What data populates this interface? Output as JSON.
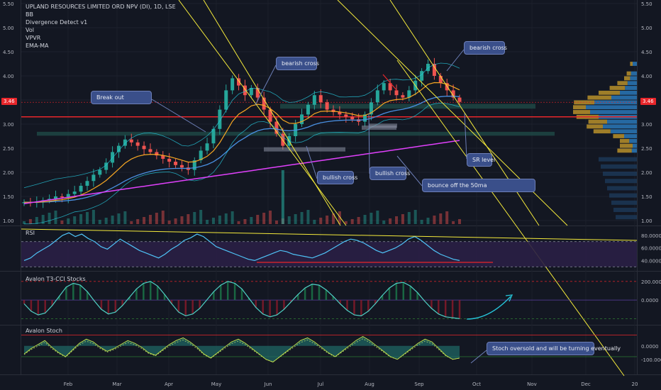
{
  "legend": [
    "UPLAND RESOURCES LIMITED ORD NPV (DI), 1D, LSE",
    "BB",
    "Divergence Detect v1",
    "Vol",
    "VPVR",
    "EMA-MA"
  ],
  "current_price": "3.46",
  "pane_titles": {
    "rsi": "RSI",
    "t3": "Avalon T3-CCI Stocks",
    "stoch": "Avalon Stoch"
  },
  "annotations": {
    "breakout": "Break out",
    "bearish1": "bearish cross",
    "bearish2": "bearish cross",
    "bullish1": "bullish cross",
    "bullish2": "bullish cross",
    "bounce": "bounce off the 50ma",
    "sr": "SR level",
    "stoch": "Stoch oversold and will be turning eventually"
  },
  "colors": {
    "background": "#131722",
    "bull": "#26a69a",
    "bear": "#ef5350",
    "support_red": "#e8262b",
    "trendline_yellow": "#f5eb3b",
    "sma200_magenta": "#e040fb",
    "rsi_line": "#4fc3f7",
    "zone_teal": "#1f4a47",
    "vpvr_up": "#b8902a",
    "vpvr_down": "#2a78b8",
    "annotation_box": "#3a4f8a"
  },
  "chart_data": [
    {
      "type": "candlestick",
      "title": "UPLAND RESOURCES LIMITED ORD NPV (DI), 1D, LSE",
      "x_axis": [
        "Feb",
        "Mar",
        "Apr",
        "May",
        "Jun",
        "Jul",
        "Aug",
        "Sep",
        "Oct",
        "Nov",
        "Dec",
        "20"
      ],
      "y_ticks": [
        "5.50",
        "5.00",
        "4.50",
        "4.00",
        "3.50",
        "3.00",
        "2.50",
        "2.00",
        "1.50",
        "1.00"
      ],
      "ylim": [
        0.9,
        5.6
      ],
      "closes": [
        1.38,
        1.37,
        1.38,
        1.42,
        1.45,
        1.5,
        1.48,
        1.55,
        1.6,
        1.72,
        1.82,
        1.95,
        2.05,
        2.2,
        2.42,
        2.55,
        2.68,
        2.62,
        2.55,
        2.48,
        2.42,
        2.35,
        2.28,
        2.22,
        2.15,
        2.1,
        2.05,
        2.25,
        2.45,
        2.6,
        2.9,
        3.3,
        3.7,
        3.95,
        3.8,
        3.6,
        3.75,
        3.55,
        3.3,
        3.05,
        2.8,
        2.55,
        2.75,
        3.0,
        3.2,
        3.4,
        3.6,
        3.45,
        3.3,
        3.25,
        3.2,
        3.15,
        3.1,
        3.05,
        3.2,
        3.45,
        3.7,
        3.85,
        3.7,
        3.6,
        3.55,
        3.7,
        3.9,
        4.1,
        4.25,
        4.0,
        3.85,
        3.7,
        3.55,
        3.46
      ],
      "current": 3.46,
      "support_level": 3.15,
      "sr_zones": [
        [
          2.76,
          2.84
        ],
        [
          3.32,
          3.42
        ]
      ],
      "series": [
        {
          "name": "SMA 200"
        },
        {
          "name": "EMA 50"
        },
        {
          "name": "EMA 20"
        },
        {
          "name": "Bollinger Bands"
        }
      ]
    },
    {
      "type": "line",
      "title": "RSI",
      "y_ticks": [
        "80.0000",
        "60.0000",
        "40.0000"
      ],
      "ylim": [
        28,
        90
      ],
      "levels": [
        70,
        30
      ],
      "values": [
        40,
        44,
        52,
        58,
        64,
        72,
        80,
        84,
        78,
        82,
        75,
        70,
        62,
        58,
        66,
        74,
        68,
        62,
        56,
        52,
        48,
        44,
        50,
        58,
        64,
        72,
        76,
        82,
        78,
        70,
        62,
        58,
        54,
        50,
        46,
        42,
        40,
        44,
        48,
        52,
        56,
        54,
        50,
        48,
        46,
        44,
        48,
        52,
        58,
        64,
        70,
        74,
        72,
        68,
        62,
        56,
        52,
        56,
        60,
        66,
        74,
        78,
        72,
        64,
        56,
        50,
        46,
        42,
        40
      ]
    },
    {
      "type": "line",
      "title": "Avalon T3-CCI Stocks",
      "y_ticks": [
        "200.0000",
        "0.0000"
      ],
      "ylim": [
        -220,
        260
      ],
      "values": [
        -40,
        -120,
        -160,
        -140,
        -60,
        40,
        140,
        180,
        160,
        90,
        -10,
        -100,
        -150,
        -130,
        -60,
        30,
        120,
        180,
        200,
        150,
        60,
        -40,
        -130,
        -170,
        -150,
        -90,
        0,
        90,
        160,
        200,
        180,
        120,
        20,
        -80,
        -150,
        -180,
        -160,
        -100,
        -20,
        60,
        130,
        170,
        160,
        110,
        40,
        -40,
        -110,
        -160,
        -170,
        -120,
        -40,
        50,
        130,
        180,
        190,
        150,
        80,
        -10,
        -90,
        -150,
        -180,
        -190,
        -200
      ]
    },
    {
      "type": "line",
      "title": "Avalon Stoch",
      "y_ticks": [
        "0.0000",
        "-100.0000"
      ],
      "ylim": [
        -180,
        120
      ],
      "values": [
        -60,
        -20,
        10,
        40,
        -10,
        -50,
        -80,
        -30,
        20,
        50,
        30,
        -10,
        -40,
        -20,
        10,
        40,
        20,
        -10,
        -50,
        -70,
        -30,
        10,
        40,
        60,
        30,
        -10,
        -60,
        -90,
        -50,
        -10,
        30,
        50,
        20,
        -20,
        -60,
        -100,
        -120,
        -80,
        -40,
        0,
        40,
        60,
        30,
        -10,
        -50,
        -80,
        -40,
        0,
        40,
        70,
        40,
        0,
        -40,
        -80,
        -100,
        -60,
        -20,
        20,
        50,
        30,
        -20,
        -70,
        -100,
        -90
      ]
    }
  ]
}
